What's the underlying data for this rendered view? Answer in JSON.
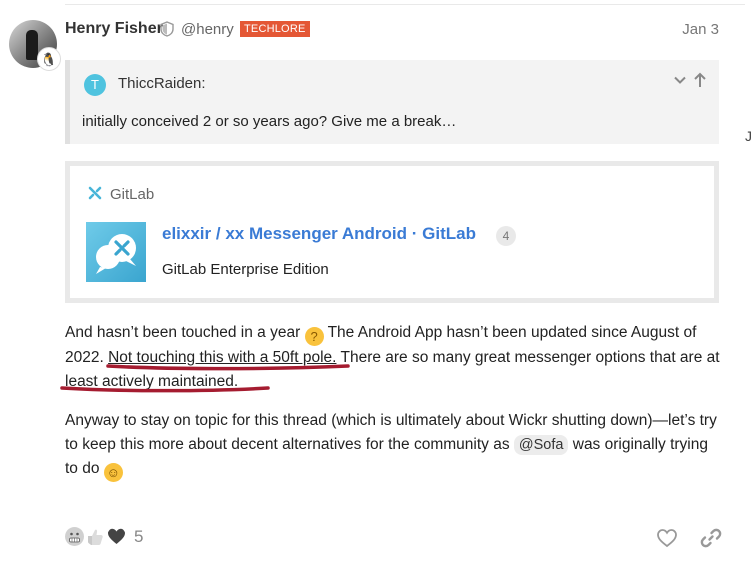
{
  "post": {
    "author_name": "Henry Fisher",
    "username": "@henry",
    "flair": "TECHLORE",
    "date": "Jan 3"
  },
  "quote": {
    "avatar_letter": "T",
    "user": "ThiccRaiden:",
    "text": "initially conceived 2 or so years ago? Give me a break…"
  },
  "onebox": {
    "site": "GitLab",
    "title": "elixxir / xx Messenger Android · GitLab",
    "count": "4",
    "description": "GitLab Enterprise Edition"
  },
  "body": {
    "p1_part1": "And hasn’t been touched in a year ",
    "p1_part2": " The Android App hasn’t been updated since August of 2022. ",
    "p1_underlined": "Not touching this with a 50ft pole.",
    "p1_part3": " There are so many great messenger options that are at least actively maintained.",
    "p2_part1": "Anyway to stay on topic for this thread (which is ultimately about Wickr shutting down)—let’s try to keep this more about decent alternatives for the community as ",
    "p2_mention": "@Sofa",
    "p2_part2": " was originally trying to do "
  },
  "reactions": {
    "icons": [
      "grimacing-face-icon",
      "thumbs-up-icon",
      "black-heart-icon"
    ],
    "count": "5"
  },
  "edge_text": "J",
  "colors": {
    "flair": "#e45735",
    "link": "#3a7bd5",
    "annotation": "#a51c30",
    "quote_avatar": "#4fc3df"
  }
}
